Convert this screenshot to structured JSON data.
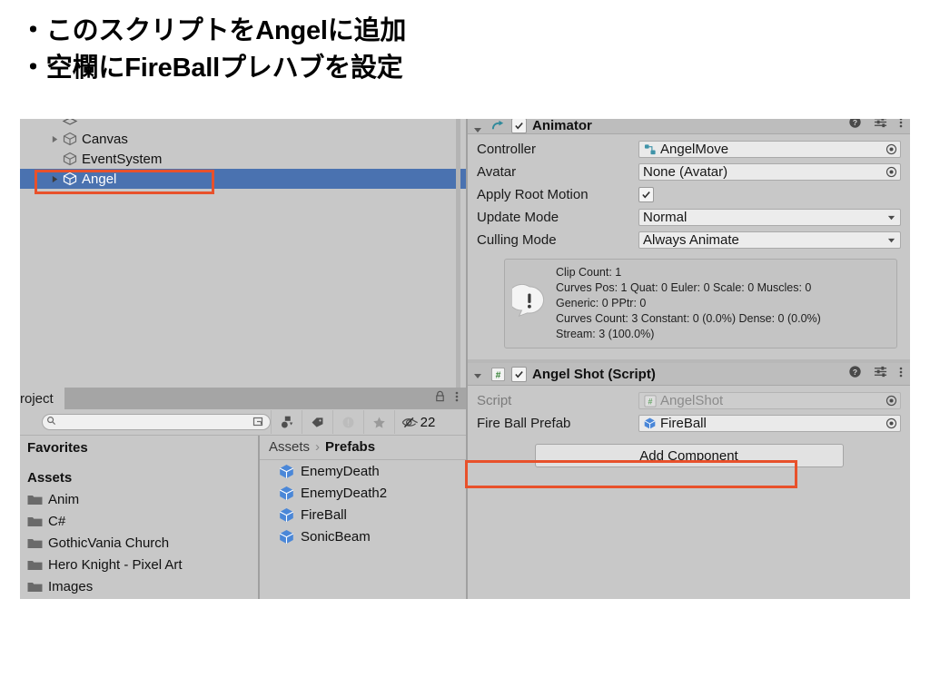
{
  "slide": {
    "lines": [
      "・このスクリプトをAngelに追加",
      "・空欄にFireBallプレハブを設定"
    ]
  },
  "hierarchy": {
    "items": [
      {
        "label": "",
        "arrow": false,
        "clipped": true,
        "selected": false
      },
      {
        "label": "Canvas",
        "arrow": true,
        "clipped": false,
        "selected": false
      },
      {
        "label": "EventSystem",
        "arrow": false,
        "clipped": false,
        "selected": false
      },
      {
        "label": "Angel",
        "arrow": true,
        "clipped": false,
        "selected": true
      }
    ]
  },
  "project": {
    "tab_label": "roject",
    "lock_icon": "lock-icon",
    "menu_icon": "kebab-menu-icon",
    "search": {
      "value": "",
      "placeholder": "",
      "icon": "search-icon",
      "sub_icon": "save-search-icon"
    },
    "toolbar_buttons": [
      {
        "name": "filter-by-type-icon",
        "label": ""
      },
      {
        "name": "filter-by-label-icon",
        "label": ""
      },
      {
        "name": "warning-filter-icon",
        "label": ""
      },
      {
        "name": "favorites-star-icon",
        "label": ""
      },
      {
        "name": "hidden-items-icon",
        "label": "22"
      }
    ],
    "favorites_header": "Favorites",
    "assets_header": "Assets",
    "folders": [
      {
        "label": "Anim"
      },
      {
        "label": "C#"
      },
      {
        "label": "GothicVania Church"
      },
      {
        "label": "Hero Knight - Pixel Art"
      },
      {
        "label": "Images"
      }
    ],
    "breadcrumb": {
      "root": "Assets",
      "separator": "›",
      "current": "Prefabs"
    },
    "assets": [
      {
        "label": "EnemyDeath",
        "icon": "prefab-cube-icon"
      },
      {
        "label": "EnemyDeath2",
        "icon": "prefab-cube-icon"
      },
      {
        "label": "FireBall",
        "icon": "prefab-cube-icon"
      },
      {
        "label": "SonicBeam",
        "icon": "prefab-cube-icon"
      }
    ]
  },
  "inspector": {
    "animator": {
      "title": "Animator",
      "enabled": true,
      "icon": "animator-icon",
      "help_icon": "help-icon",
      "preset_icon": "preset-icon",
      "menu_icon": "kebab-menu-icon",
      "fields": [
        {
          "label": "Controller",
          "value": "AngelMove",
          "type": "objectref",
          "icon": "animator-controller-icon"
        },
        {
          "label": "Avatar",
          "value": "None (Avatar)",
          "type": "objectref",
          "icon": ""
        },
        {
          "label": "Apply Root Motion",
          "value": "",
          "type": "checkbox",
          "checked": true
        },
        {
          "label": "Update Mode",
          "value": "Normal",
          "type": "dropdown"
        },
        {
          "label": "Culling Mode",
          "value": "Always Animate",
          "type": "dropdown"
        }
      ],
      "info": {
        "icon": "info-bubble-icon",
        "lines": [
          "Clip Count: 1",
          "Curves Pos: 1 Quat: 0 Euler: 0 Scale: 0 Muscles: 0",
          "Generic: 0 PPtr: 0",
          "Curves Count: 3 Constant: 0 (0.0%) Dense: 0 (0.0%)",
          "Stream: 3 (100.0%)"
        ]
      }
    },
    "angel_shot": {
      "title": "Angel Shot (Script)",
      "enabled": true,
      "icon": "csharp-script-icon",
      "help_icon": "help-icon",
      "preset_icon": "preset-icon",
      "menu_icon": "kebab-menu-icon",
      "fields": [
        {
          "label": "Script",
          "value": "AngelShot",
          "type": "objectref",
          "icon": "csharp-script-icon",
          "disabled": true
        },
        {
          "label": "Fire Ball Prefab",
          "value": "FireBall",
          "type": "objectref",
          "icon": "prefab-cube-icon",
          "disabled": false
        }
      ]
    },
    "add_component_label": "Add Component"
  },
  "colors": {
    "selection_blue": "#4a72b0",
    "annotation_red": "#e8512b",
    "panel_bg": "#c8c8c8",
    "header_bg": "#bdbdbd",
    "field_bg": "#f0f0f0",
    "prefab_blue": "#4a87d8"
  }
}
